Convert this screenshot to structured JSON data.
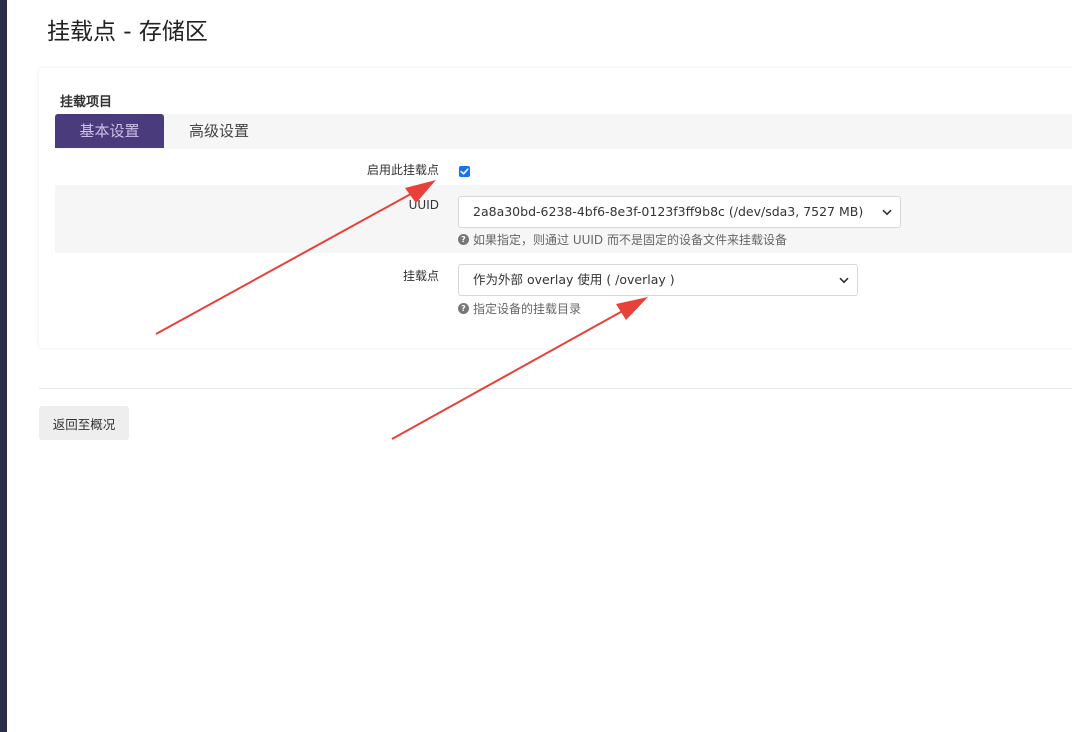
{
  "page": {
    "title": "挂载点 - 存储区"
  },
  "section": {
    "title": "挂载项目"
  },
  "tabs": [
    {
      "label": "基本设置",
      "active": true
    },
    {
      "label": "高级设置",
      "active": false
    }
  ],
  "fields": {
    "enable": {
      "label": "启用此挂载点",
      "checked": true
    },
    "uuid": {
      "label": "UUID",
      "value": "2a8a30bd-6238-4bf6-8e3f-0123f3ff9b8c (/dev/sda3, 7527 MB)",
      "hint": "如果指定，则通过 UUID 而不是固定的设备文件来挂载设备"
    },
    "mount_point": {
      "label": "挂载点",
      "value": "作为外部 overlay 使用 ( /overlay )",
      "hint": "指定设备的挂载目录"
    }
  },
  "actions": {
    "back_label": "返回至概况"
  },
  "colors": {
    "sidebar": "#2b2e48",
    "active_tab_bg": "#4a3b7c",
    "active_tab_text": "#cdbfe8",
    "checkbox": "#1a73e8",
    "annotation_arrow": "#e8413a"
  },
  "icons": {
    "hint_icon": "question-circle-icon",
    "select_icon": "chevron-down-icon",
    "check_icon": "checkmark-icon",
    "annotation": "red-arrow-annotation"
  }
}
